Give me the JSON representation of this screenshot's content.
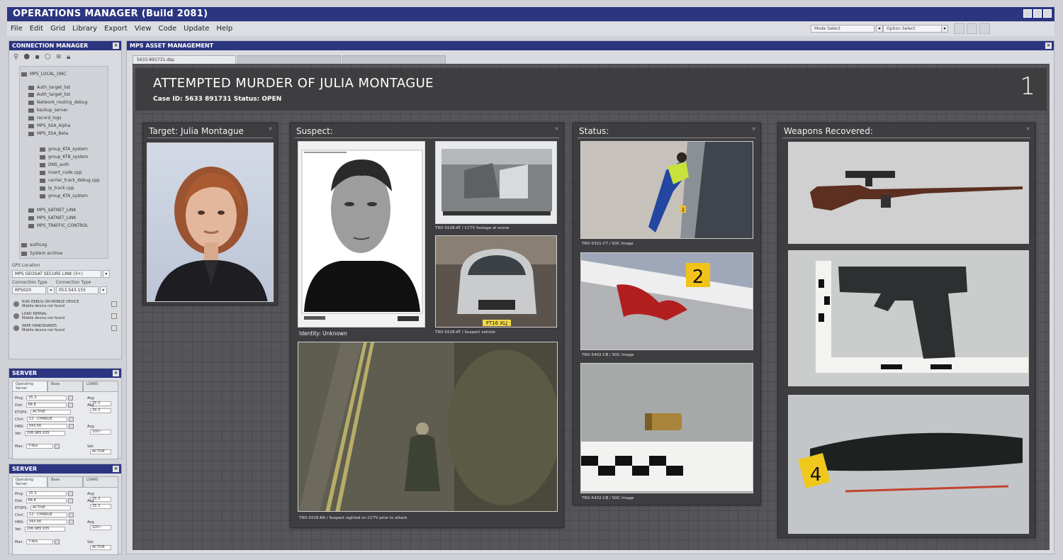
{
  "window": {
    "title": "OPERATIONS MANAGER  (Build  2081)"
  },
  "menu": {
    "items": [
      "File",
      "Edit",
      "Grid",
      "Library",
      "Export",
      "View",
      "Code",
      "Update",
      "Help"
    ],
    "mode_select": "Mode Select",
    "option_select": "Option Select"
  },
  "connection_manager": {
    "title": "CONNECTION MANAGER",
    "tree": {
      "root": "MPS_LOCAL_DNC",
      "items": [
        "Auth_target_list",
        "Auth_target_list",
        "Network_routing_debug",
        "backup_server",
        "record_logs",
        "MPS_SSA_Alpha",
        "MPS_SSA_Beta"
      ],
      "subitems": [
        "group_KTA_system",
        "group_KTB_system",
        "DNS_auth",
        "insert_code.cpp",
        "carrier_track_debug.cpp",
        "lp_track.cpp",
        "group_KTA_system"
      ],
      "items2": [
        "MPS_SATNET_LINK",
        "MPS_SATNET_LINK",
        "MPS_TRAFFIC_CONTROL"
      ],
      "bottom": [
        "authLog",
        "System archive"
      ]
    },
    "gps_label": "GPS Location",
    "gps_value": "MPS GEOSAT SECURE LINK (3+)",
    "conn_type_label": "Connection Type",
    "conn_type_label2": "Connection Type",
    "conn_value1": "RPS020",
    "conn_value2": "053.543.155",
    "commands": [
      {
        "title": "RUN DEBUG ON MOBILE DEVICE",
        "sub": "Mobile device not found"
      },
      {
        "title": "LOAD KERNAL",
        "sub": "Mobile device not found"
      },
      {
        "title": "WIPE HANDSHAKES",
        "sub": "Mobile device not found"
      }
    ]
  },
  "servers": [
    {
      "title": "SERVER",
      "tabs": [
        "Operating Server",
        "Base",
        "LOARS"
      ],
      "rows": [
        {
          "label": "Ping:",
          "value": "25.3"
        },
        {
          "label": "Dist:",
          "value": "68.8"
        },
        {
          "label": "ETOPS:",
          "value": "ACTIVE"
        },
        {
          "label": "Chnl:",
          "value": "12 - CHARLIE"
        },
        {
          "label": "HRN:",
          "value": "343.56"
        },
        {
          "label": "Vet:",
          "value": "206.985.935"
        },
        {
          "label": "Max:",
          "value": "T-N/a"
        }
      ],
      "right": [
        {
          "label": "Avg:",
          "value": "25.3"
        },
        {
          "label": "Avg:",
          "value": "25.3"
        },
        {
          "label": "Avg:",
          "value": "100~"
        },
        {
          "label": "Sat:",
          "value": "ACTIVE"
        }
      ]
    },
    {
      "title": "SERVER",
      "tabs": [
        "Operating Server",
        "Base",
        "LOARS"
      ],
      "rows": [
        {
          "label": "Ping:",
          "value": "25.3"
        },
        {
          "label": "Dist:",
          "value": "68.8"
        },
        {
          "label": "ETOPS:",
          "value": "ACTIVE"
        },
        {
          "label": "Chnl:",
          "value": "12 - CHARLIE"
        },
        {
          "label": "HRN:",
          "value": "343.56"
        },
        {
          "label": "Vet:",
          "value": "206.985.935"
        },
        {
          "label": "Max:",
          "value": "T-N/a"
        }
      ],
      "right": [
        {
          "label": "Avg:",
          "value": "25.3"
        },
        {
          "label": "Avg:",
          "value": "25.3"
        },
        {
          "label": "Avg:",
          "value": "100~"
        },
        {
          "label": "Sat:",
          "value": "ACTIVE"
        }
      ]
    }
  ],
  "asset": {
    "title": "MPS ASSET MANAGEMENT",
    "tab": "5633-891731.dsp",
    "header": {
      "title": "ATTEMPTED MURDER OF JULIA MONTAGUE",
      "case_id": "Case ID: 5633 891731   Status: OPEN",
      "number": "1"
    },
    "cards": {
      "target": {
        "title": "Target: Julia Montague"
      },
      "suspect": {
        "title": "Suspect:",
        "identity": "Identity: Unknown",
        "cctv_caption": "TRO-5528-AT / CCTV footage at scene",
        "vehicle_caption": "TRO-5528-AT / Suspect vehicle",
        "sighted_caption": "TRO-5526-BA / Suspect sighted on CCTV prior to attack",
        "plate": "FT16 XLJ"
      },
      "status": {
        "title": "Status:",
        "cap1": "TRO-5321-CT / SOC Image",
        "cap2": "TRO-5402-CB / SOC Image",
        "cap3": "TRO-5432-CB / SOC Image",
        "marker1": "1",
        "marker2": "2"
      },
      "weapons": {
        "title": "Weapons Recovered:",
        "marker4": "4"
      }
    }
  },
  "colors": {
    "titlebar": "#2b3580",
    "board": "#55555a",
    "card": "#3e3e41"
  }
}
